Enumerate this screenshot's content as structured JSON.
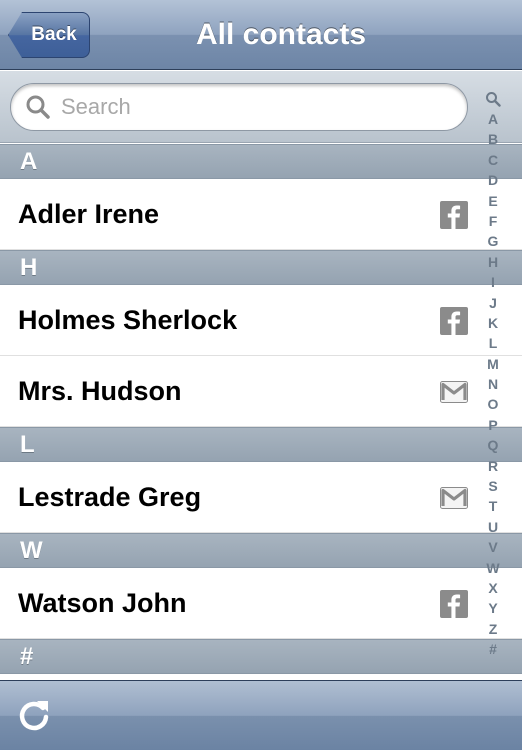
{
  "navbar": {
    "back_label": "Back",
    "title": "All contacts"
  },
  "search": {
    "placeholder": "Search"
  },
  "sections": [
    {
      "letter": "A",
      "contacts": [
        {
          "name": "Adler Irene",
          "source": "facebook-icon"
        }
      ]
    },
    {
      "letter": "H",
      "contacts": [
        {
          "name": "Holmes Sherlock",
          "source": "facebook-icon"
        },
        {
          "name": "Mrs. Hudson",
          "source": "gmail-icon"
        }
      ]
    },
    {
      "letter": "L",
      "contacts": [
        {
          "name": "Lestrade Greg",
          "source": "gmail-icon"
        }
      ]
    },
    {
      "letter": "W",
      "contacts": [
        {
          "name": "Watson John",
          "source": "facebook-icon"
        }
      ]
    },
    {
      "letter": "#",
      "contacts": []
    }
  ],
  "index": [
    "A",
    "B",
    "C",
    "D",
    "E",
    "F",
    "G",
    "H",
    "I",
    "J",
    "K",
    "L",
    "M",
    "N",
    "O",
    "P",
    "Q",
    "R",
    "S",
    "T",
    "U",
    "V",
    "W",
    "X",
    "Y",
    "Z",
    "#"
  ],
  "toolbar": {
    "refresh_icon": "refresh-icon"
  },
  "colors": {
    "nav_blue": "#7b91b0",
    "back_button": "#4566a0",
    "section_header": "#9eabb8",
    "index_text": "#6c7a89"
  }
}
